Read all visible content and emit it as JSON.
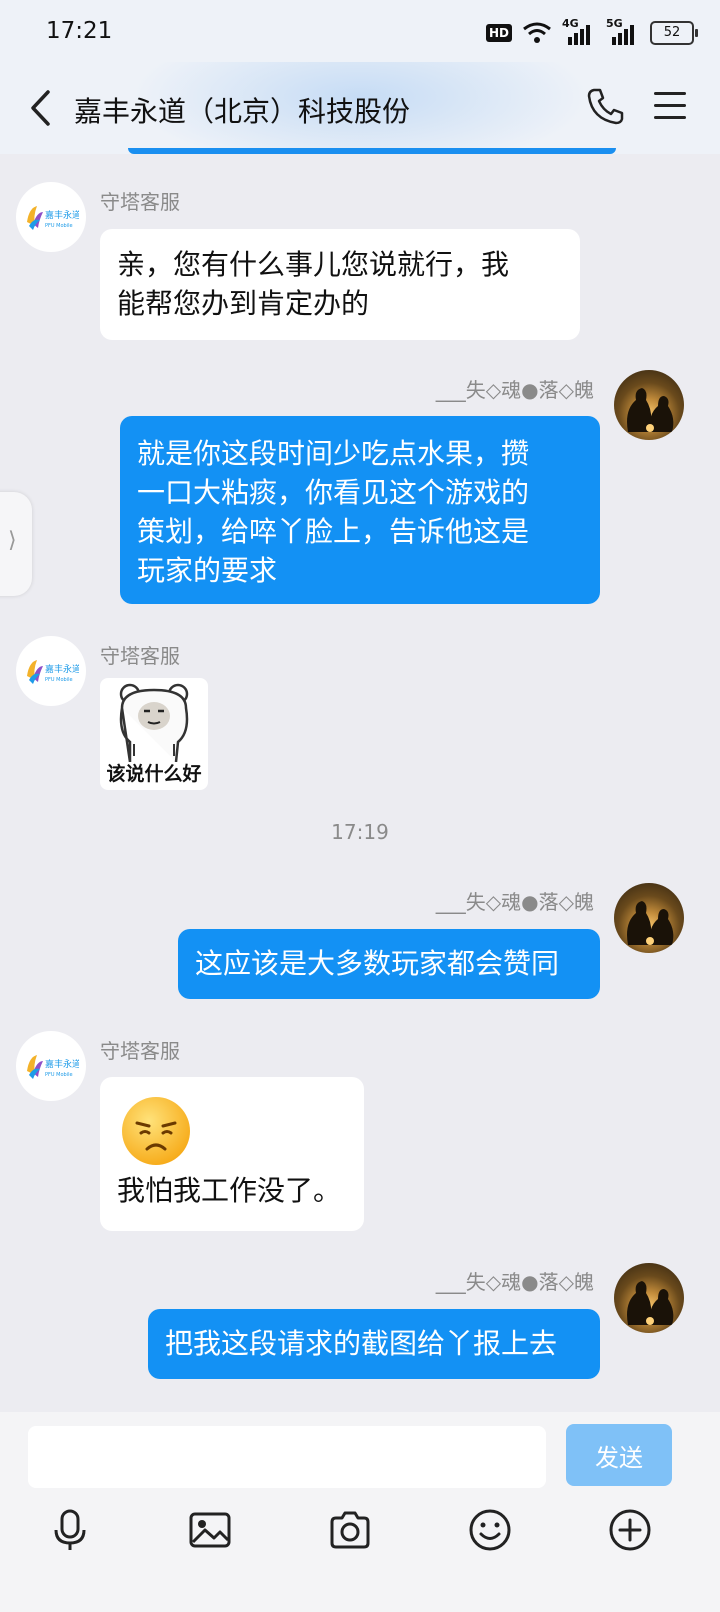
{
  "status_bar": {
    "time": "17:21",
    "hd_label": "HD",
    "network_1": "4G",
    "network_2": "5G",
    "battery": "52"
  },
  "header": {
    "title": "嘉丰永道（北京）科技股份"
  },
  "logo": {
    "brand": "嘉丰永道",
    "sub": "PFU Mobile"
  },
  "side_tab": {
    "glyph": "⟩"
  },
  "messages": [
    {
      "sender": "守塔客服",
      "text": "亲，您有什么事儿您说就行，我\n能帮您办到肯定办的"
    },
    {
      "sender": "___失◇魂●落◇魄",
      "text": "就是你这段时间少吃点水果，攒\n一口大粘痰，你看见这个游戏的\n策划，给啐丫脸上，告诉他这是\n玩家的要求"
    },
    {
      "sender": "守塔客服",
      "sticker_caption": "该说什么好"
    },
    {
      "sender": "___失◇魂●落◇魄",
      "text": "这应该是大多数玩家都会赞同"
    },
    {
      "sender": "守塔客服",
      "text": "我怕我工作没了。"
    },
    {
      "sender": "___失◇魂●落◇魄",
      "text": "把我这段请求的截图给丫报上去"
    }
  ],
  "timestamp": "17:19",
  "input": {
    "placeholder": "",
    "send_label": "发送"
  },
  "toolbar": [
    "microphone-icon",
    "image-icon",
    "camera-icon",
    "emoji-icon",
    "plus-icon"
  ],
  "colors": {
    "accent": "#1391f4",
    "send_disabled": "#7fc1f7",
    "background": "#ececf1"
  }
}
